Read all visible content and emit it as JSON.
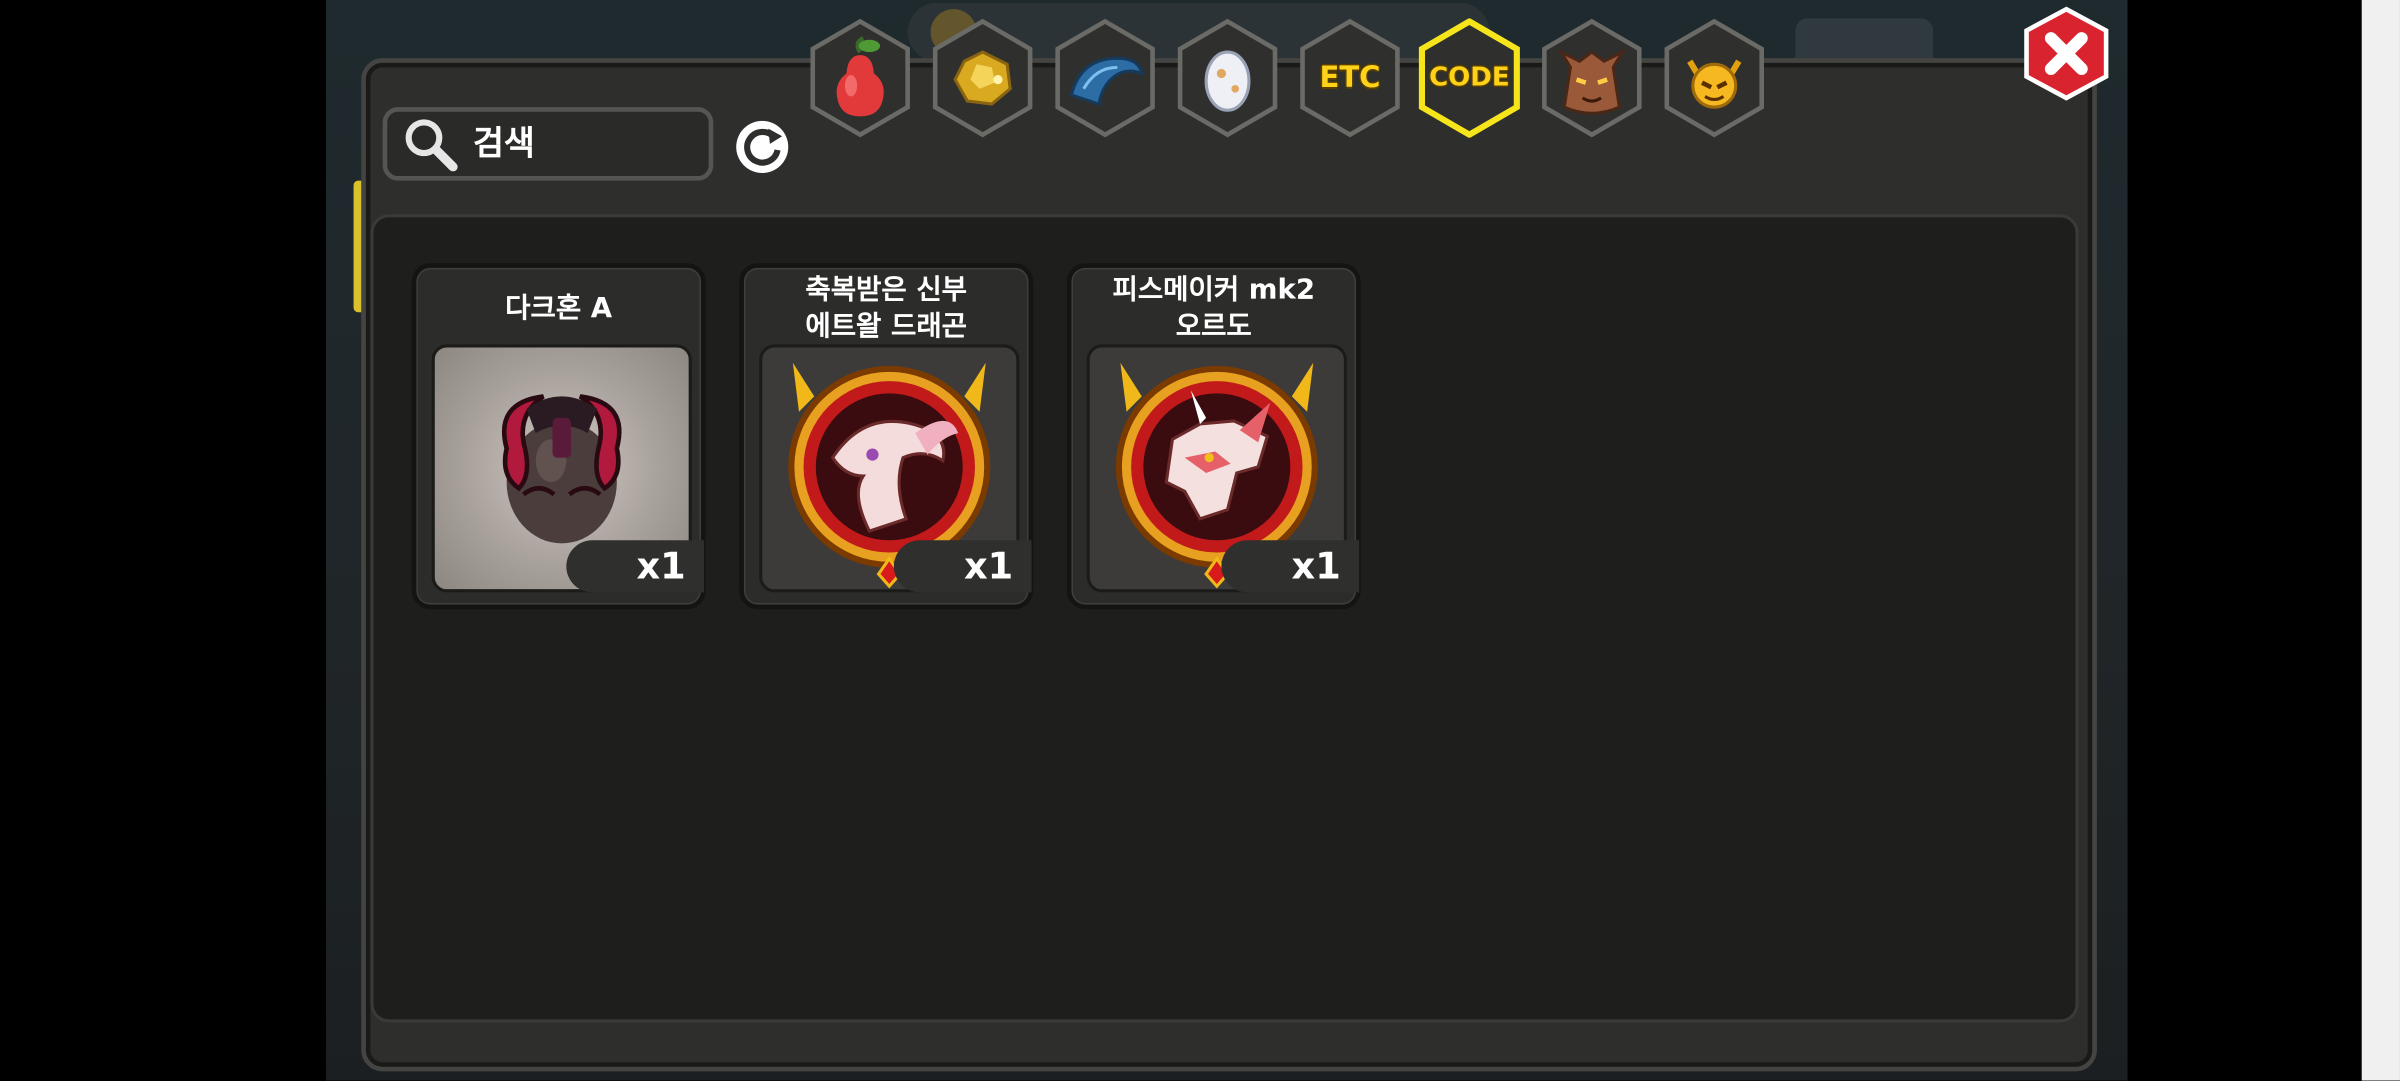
{
  "search": {
    "placeholder": "검색"
  },
  "tabs": [
    {
      "name": "fruit",
      "icon": "pear-icon"
    },
    {
      "name": "gold",
      "icon": "gold-ore-icon"
    },
    {
      "name": "scale",
      "icon": "dragon-scale-icon"
    },
    {
      "name": "egg",
      "icon": "egg-icon"
    },
    {
      "name": "etc",
      "label": "ETC"
    },
    {
      "name": "code",
      "label": "CODE",
      "selected": true
    },
    {
      "name": "beast",
      "icon": "werewolf-icon"
    },
    {
      "name": "demon",
      "icon": "demon-face-icon"
    }
  ],
  "items": [
    {
      "name": "다크혼 A",
      "quantity": "x1",
      "icon": "dark-horn-egg-icon"
    },
    {
      "name": "축복받은 신부\n에트왈 드래곤",
      "quantity": "x1",
      "icon": "bride-etoile-dragon-emblem-icon"
    },
    {
      "name": "피스메이커 mk2\n오르도",
      "quantity": "x1",
      "icon": "peacemaker-ordo-emblem-icon"
    }
  ],
  "colors": {
    "selected_tab_glow": "#f5e51a",
    "tab_text": "#ffd21a",
    "close_red": "#d9232e",
    "panel_bg": "#2e2e2c"
  }
}
